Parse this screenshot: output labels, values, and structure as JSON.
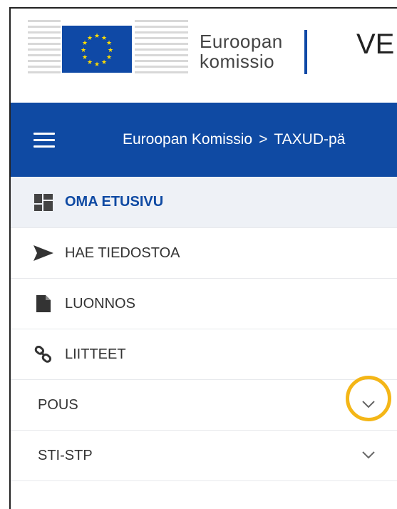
{
  "header": {
    "logo_line1": "Euroopan",
    "logo_line2": "komissio",
    "title": "VE"
  },
  "navbar": {
    "breadcrumb": [
      {
        "label": "Euroopan Komissio"
      },
      {
        "label": "TAXUD-pä"
      }
    ],
    "separator": ">"
  },
  "menu": {
    "items": [
      {
        "label": "OMA ETUSIVU",
        "icon": "dashboard-icon",
        "active": true
      },
      {
        "label": "HAE TIEDOSTOA",
        "icon": "send-icon"
      },
      {
        "label": "LUONNOS",
        "icon": "document-icon"
      },
      {
        "label": "LIITTEET",
        "icon": "link-icon"
      }
    ],
    "groups": [
      {
        "label": "POUS",
        "icon": "chevron-down-icon",
        "highlighted": true
      },
      {
        "label": "STI-STP",
        "icon": "chevron-down-icon"
      }
    ]
  },
  "colors": {
    "brand_blue": "#0f4aa3",
    "highlight": "#f4b617",
    "active_bg": "#eef1f6"
  }
}
